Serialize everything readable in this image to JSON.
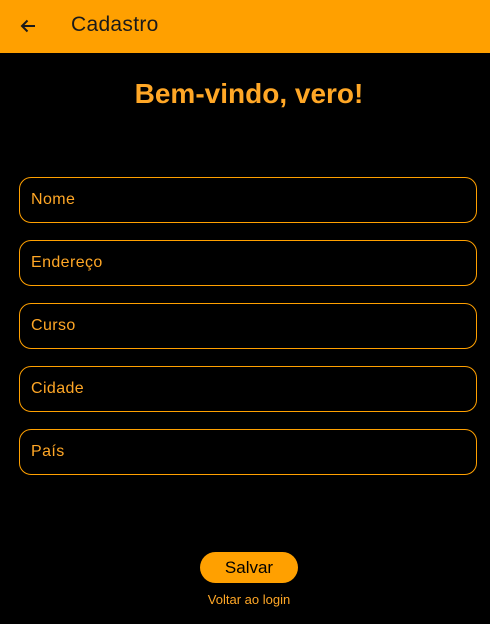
{
  "app_bar": {
    "title": "Cadastro",
    "back_icon": "arrow-left-icon",
    "background": "#FFA000"
  },
  "welcome": {
    "text": "Bem-vindo, vero!"
  },
  "form": {
    "fields": [
      {
        "label": "Nome",
        "value": ""
      },
      {
        "label": "Endereço",
        "value": ""
      },
      {
        "label": "Curso",
        "value": ""
      },
      {
        "label": "Cidade",
        "value": ""
      },
      {
        "label": "País",
        "value": ""
      }
    ]
  },
  "actions": {
    "save_label": "Salvar",
    "back_to_login_label": "Voltar ao login"
  },
  "colors": {
    "accent": "#FFA000",
    "text_accent": "#FFA726",
    "background": "#000000"
  }
}
